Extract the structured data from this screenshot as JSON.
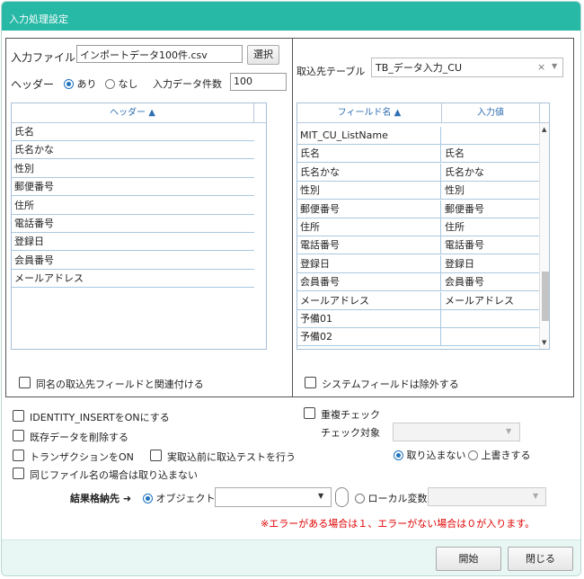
{
  "dialog": {
    "title": "入力処理設定"
  },
  "input": {
    "file_label": "入力ファイル",
    "file_value": "インポートデータ100件.csv",
    "select_button": "選択",
    "header_label": "ヘッダー",
    "header_yes": "あり",
    "header_no": "なし",
    "header_selected": "あり",
    "count_label": "入力データ件数",
    "count_value": "100"
  },
  "left_grid": {
    "column": "ヘッダー ▲",
    "rows": [
      "氏名",
      "氏名かな",
      "性別",
      "郵便番号",
      "住所",
      "電話番号",
      "登録日",
      "会員番号",
      "メールアドレス"
    ]
  },
  "left_checkbox": "同名の取込先フィールドと関連付ける",
  "target": {
    "label": "取込先テーブル",
    "value": "TB_データ入力_CU",
    "clear": "×",
    "caret": "▼"
  },
  "right_grid": {
    "columns": [
      "フィールド名 ▲",
      "入力値"
    ],
    "rows": [
      [
        "MIT_CU_ListName",
        ""
      ],
      [
        "氏名",
        "氏名"
      ],
      [
        "氏名かな",
        "氏名かな"
      ],
      [
        "性別",
        "性別"
      ],
      [
        "郵便番号",
        "郵便番号"
      ],
      [
        "住所",
        "住所"
      ],
      [
        "電話番号",
        "電話番号"
      ],
      [
        "登録日",
        "登録日"
      ],
      [
        "会員番号",
        "会員番号"
      ],
      [
        "メールアドレス",
        "メールアドレス"
      ],
      [
        "予備01",
        ""
      ],
      [
        "予備02",
        ""
      ]
    ]
  },
  "right_checkbox": "システムフィールドは除外する",
  "options": {
    "identity_insert": "IDENTITY_INSERTをONにする",
    "delete_existing": "既存データを削除する",
    "transaction": "トランザクションをON",
    "test_before": "実取込前に取込テストを行う",
    "skip_same_file": "同じファイル名の場合は取り込まない",
    "duplicate_check": "重複チェック",
    "check_target": "チェック対象",
    "no_import": "取り込まない",
    "overwrite": "上書きする",
    "dup_selected": "取り込まない"
  },
  "result": {
    "label": "結果格納先 ➜",
    "object": "オブジェクト",
    "local": "ローカル変数",
    "selected": "オブジェクト",
    "note": "※エラーがある場合は１、エラーがない場合は０が入ります。"
  },
  "footer": {
    "start": "開始",
    "close": "閉じる"
  },
  "colors": {
    "title_bar": "#27b8a6",
    "footer": "#e8f7f4",
    "note": "#e00000",
    "grid_header_text": "#2f6fb1"
  }
}
